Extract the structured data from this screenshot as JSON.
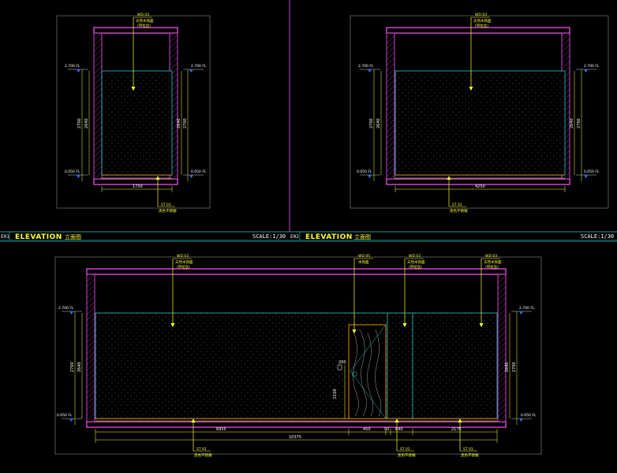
{
  "title_blocks": [
    {
      "code": "E01",
      "title": "ELEVATION",
      "cn": "立面图",
      "scale": "SCALE:1/30"
    },
    {
      "code": "E02",
      "title": "ELEVATION",
      "cn": "立面图",
      "scale": "SCALE:1/30"
    }
  ],
  "elevation_1": {
    "ceiling_tag": {
      "code": "WD 03",
      "line1": "天然木饰面",
      "line2": "(带拉丝)"
    },
    "floor_tag": {
      "code": "ST 01",
      "line1": "黑色不锈钢"
    },
    "level_top_left": "2.700 FL",
    "level_top_right": "2.700 FL",
    "level_bottom_left": "0.050 FL",
    "level_bottom_right": "0.050 FL",
    "dim_outer_left": "2700",
    "dim_inner_left": "2640",
    "dim_inner_right": "2640",
    "dim_outer_right": "2700",
    "dim_width": "1750"
  },
  "elevation_2": {
    "ceiling_tag": {
      "code": "WD 03",
      "line1": "天然木饰面",
      "line2": "(带拉丝)"
    },
    "floor_tag": {
      "code": "ST 01",
      "line1": "黑色不锈钢"
    },
    "level_top_left": "2.700 FL",
    "level_top_right": "2.700 FL",
    "level_bottom_left": "0.050 FL",
    "level_bottom_right": "0.050 FL",
    "dim_outer_left": "2700",
    "dim_inner_left": "2640",
    "dim_inner_right": "2640",
    "dim_outer_right": "2700",
    "dim_width": "4250"
  },
  "elevation_3": {
    "tag_1": {
      "code": "WD 03",
      "line1": "天然木饰面",
      "line2": "(带拉丝)"
    },
    "tag_2": {
      "code": "WD 05",
      "line1": "木饰面"
    },
    "tag_3": {
      "code": "WD 03",
      "line1": "天然木饰面",
      "line2": "(带拉丝)"
    },
    "tag_4": {
      "code": "WD 03",
      "line1": "天然木饰面",
      "line2": "(带拉丝)"
    },
    "floor_tag_1": {
      "code": "ST 01",
      "line1": "黑色不锈钢"
    },
    "floor_tag_2": {
      "code": "ST 01",
      "line1": "黑色不锈钢"
    },
    "floor_tag_3": {
      "code": "ST 01",
      "line1": "黑色不锈钢"
    },
    "level_top_left": "2.700 FL",
    "level_top_right": "2.700 FL",
    "level_bottom_left": "0.050 FL",
    "level_bottom_right": "0.050 FL",
    "dim_outer_left": "2700",
    "dim_inner_left": "2640",
    "dim_inner_right": "2640",
    "dim_outer_right": "2700",
    "dim_door_small": "200",
    "dim_door_height": "1100",
    "dim_seg_1": "6955",
    "dim_seg_2": "450",
    "dim_seg_3": "50",
    "dim_seg_4": "640",
    "dim_seg_5": "2175",
    "dim_total": "10375"
  },
  "colors": {
    "frame": "#cc44cc",
    "cyan": "#22c8c8",
    "yellow": "#ffff33",
    "orange": "#ff9900",
    "blue": "#2a6cff",
    "border": "#8a8a8a"
  }
}
